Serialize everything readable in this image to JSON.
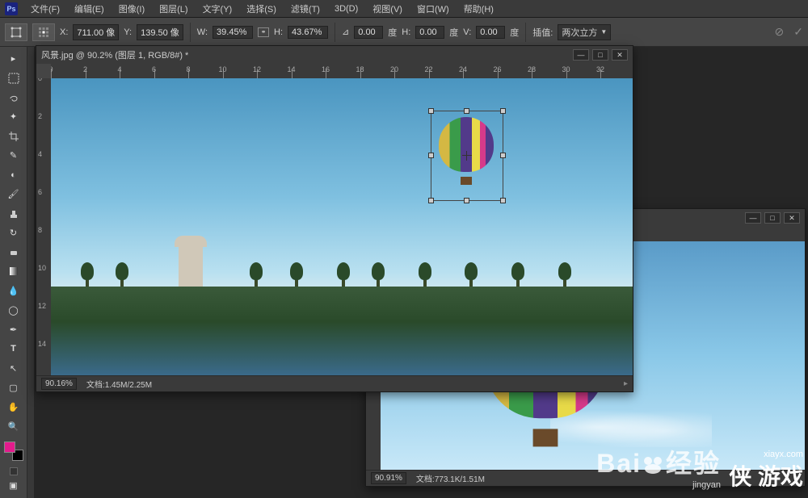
{
  "app": {
    "logo": "Ps"
  },
  "menu": {
    "items": [
      "文件(F)",
      "编辑(E)",
      "图像(I)",
      "图层(L)",
      "文字(Y)",
      "选择(S)",
      "滤镜(T)",
      "3D(D)",
      "视图(V)",
      "窗口(W)",
      "帮助(H)"
    ]
  },
  "options": {
    "x_label": "X:",
    "x_value": "711.00 像",
    "y_label": "Y:",
    "y_value": "139.50 像",
    "w_label": "W:",
    "w_value": "39.45%",
    "h_label": "H:",
    "h_value": "43.67%",
    "angle_label": "⊿",
    "angle_value": "0.00",
    "angle_unit": "度",
    "h2_label": "H:",
    "h2_value": "0.00",
    "h2_unit": "度",
    "v_label": "V:",
    "v_value": "0.00",
    "v_unit": "度",
    "interp_label": "插值:",
    "interp_value": "两次立方"
  },
  "toolbox": {
    "tools": [
      "move",
      "marquee",
      "lasso",
      "wand",
      "crop",
      "eyedropper",
      "healing",
      "brush",
      "stamp",
      "history",
      "eraser",
      "gradient",
      "blur",
      "dodge",
      "pen",
      "type",
      "path",
      "shape",
      "hand",
      "zoom"
    ]
  },
  "doc1": {
    "title": "风景.jpg @ 90.2% (图层 1, RGB/8#) *",
    "zoom": "90.16%",
    "status_label": "文档:",
    "status_value": "1.45M/2.25M",
    "ruler_h": [
      0,
      2,
      4,
      6,
      8,
      10,
      12,
      14,
      16,
      18,
      20,
      22,
      24,
      26,
      28,
      30,
      32
    ],
    "ruler_v": [
      0,
      2,
      4,
      6,
      8,
      10,
      12,
      14
    ]
  },
  "doc2": {
    "zoom": "90.91%",
    "status_label": "文档:",
    "status_value": "773.1K/1.51M"
  },
  "watermark1": {
    "big1": "Bai",
    "big2": "经验",
    "small": "jingyan"
  },
  "watermark2": {
    "top": "xiayx.com",
    "big": "侠 游戏"
  }
}
